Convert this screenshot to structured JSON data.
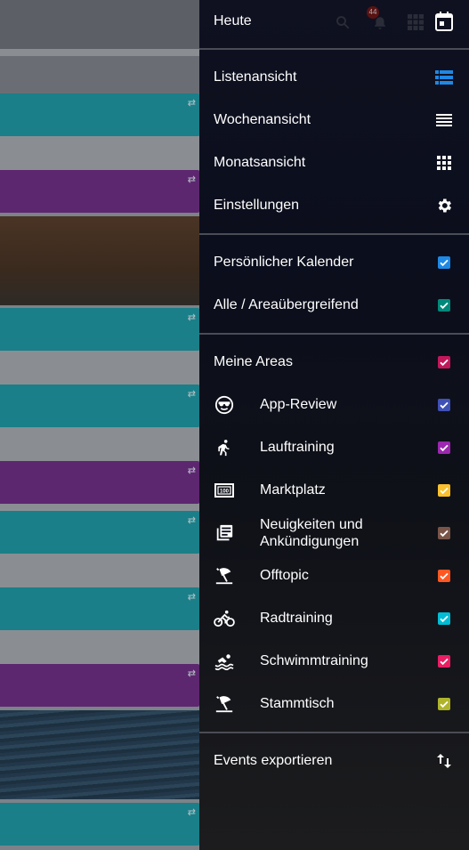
{
  "header": {
    "title": "Heute",
    "notification_count": "44"
  },
  "views": [
    {
      "label": "Listenansicht",
      "icon": "list-view-icon",
      "active": true
    },
    {
      "label": "Wochenansicht",
      "icon": "week-view-icon"
    },
    {
      "label": "Monatsansicht",
      "icon": "month-view-icon"
    },
    {
      "label": "Einstellungen",
      "icon": "gear-icon"
    }
  ],
  "calendars": [
    {
      "label": "Persönlicher Kalender",
      "color": "#1e88e5",
      "checked": true
    },
    {
      "label": "Alle / Areaübergreifend",
      "color": "#00897b",
      "checked": true
    }
  ],
  "areas_header": {
    "label": "Meine Areas",
    "color": "#c2185b",
    "checked": true
  },
  "areas": [
    {
      "label": "App-Review",
      "icon": "sunglasses-icon",
      "color": "#3f51b5",
      "checked": true
    },
    {
      "label": "Lauftraining",
      "icon": "runner-icon",
      "color": "#9c27b0",
      "checked": true
    },
    {
      "label": "Marktplatz",
      "icon": "banknote-icon",
      "color": "#fbc02d",
      "checked": true
    },
    {
      "label": "Neuigkeiten und Ankündigungen",
      "icon": "news-icon",
      "color": "#795548",
      "checked": true
    },
    {
      "label": "Offtopic",
      "icon": "beach-icon",
      "color": "#ff5722",
      "checked": true
    },
    {
      "label": "Radtraining",
      "icon": "bicycle-icon",
      "color": "#00bcd4",
      "checked": true
    },
    {
      "label": "Schwimmtraining",
      "icon": "swimmer-icon",
      "color": "#e91e63",
      "checked": true
    },
    {
      "label": "Stammtisch",
      "icon": "beach-icon",
      "color": "#afb42b",
      "checked": true
    }
  ],
  "export": {
    "label": "Events exportieren",
    "icon": "swap-vertical-icon"
  },
  "colors": {
    "drawer_bg": "#0f1120",
    "accent_blue": "#1e88e5",
    "event_teal": "#1a7f88",
    "event_purple": "#5d2770"
  }
}
